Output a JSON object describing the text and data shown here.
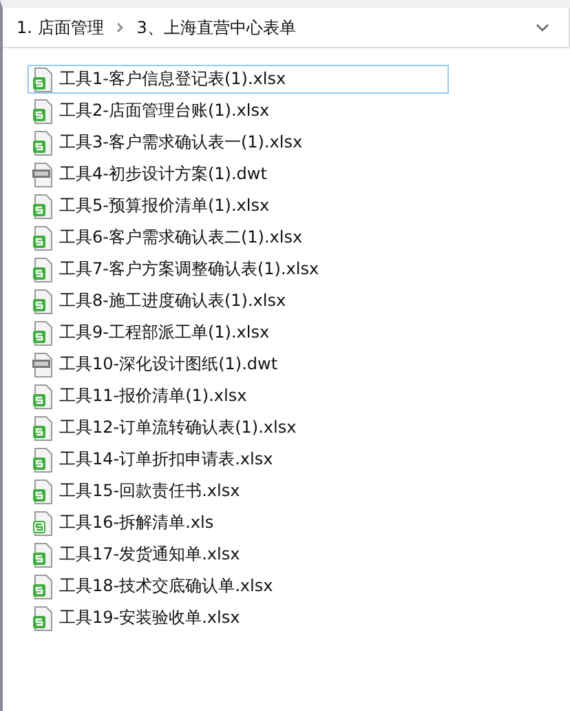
{
  "breadcrumb": [
    {
      "label": "1. 店面管理"
    },
    {
      "label": "3、上海直营中心表单"
    }
  ],
  "files": [
    {
      "name": "工具1-客户信息登记表(1).xlsx",
      "kind": "xlsx",
      "selected": true
    },
    {
      "name": "工具2-店面管理台账(1).xlsx",
      "kind": "xlsx",
      "selected": false
    },
    {
      "name": "工具3-客户需求确认表一(1).xlsx",
      "kind": "xlsx",
      "selected": false
    },
    {
      "name": "工具4-初步设计方案(1).dwt",
      "kind": "dwt",
      "selected": false
    },
    {
      "name": "工具5-预算报价清单(1).xlsx",
      "kind": "xlsx",
      "selected": false
    },
    {
      "name": "工具6-客户需求确认表二(1).xlsx",
      "kind": "xlsx",
      "selected": false
    },
    {
      "name": "工具7-客户方案调整确认表(1).xlsx",
      "kind": "xlsx",
      "selected": false
    },
    {
      "name": "工具8-施工进度确认表(1).xlsx",
      "kind": "xlsx",
      "selected": false
    },
    {
      "name": "工具9-工程部派工单(1).xlsx",
      "kind": "xlsx",
      "selected": false
    },
    {
      "name": "工具10-深化设计图纸(1).dwt",
      "kind": "dwt",
      "selected": false
    },
    {
      "name": "工具11-报价清单(1).xlsx",
      "kind": "xlsx",
      "selected": false
    },
    {
      "name": "工具12-订单流转确认表(1).xlsx",
      "kind": "xlsx",
      "selected": false
    },
    {
      "name": "工具14-订单折扣申请表.xlsx",
      "kind": "xlsx",
      "selected": false
    },
    {
      "name": "工具15-回款责任书.xlsx",
      "kind": "xlsx",
      "selected": false
    },
    {
      "name": "工具16-拆解清单.xls",
      "kind": "xls",
      "selected": false
    },
    {
      "name": "工具17-发货通知单.xlsx",
      "kind": "xlsx",
      "selected": false
    },
    {
      "name": "工具18-技术交底确认单.xlsx",
      "kind": "xlsx",
      "selected": false
    },
    {
      "name": "工具19-安装验收单.xlsx",
      "kind": "xlsx",
      "selected": false
    }
  ]
}
